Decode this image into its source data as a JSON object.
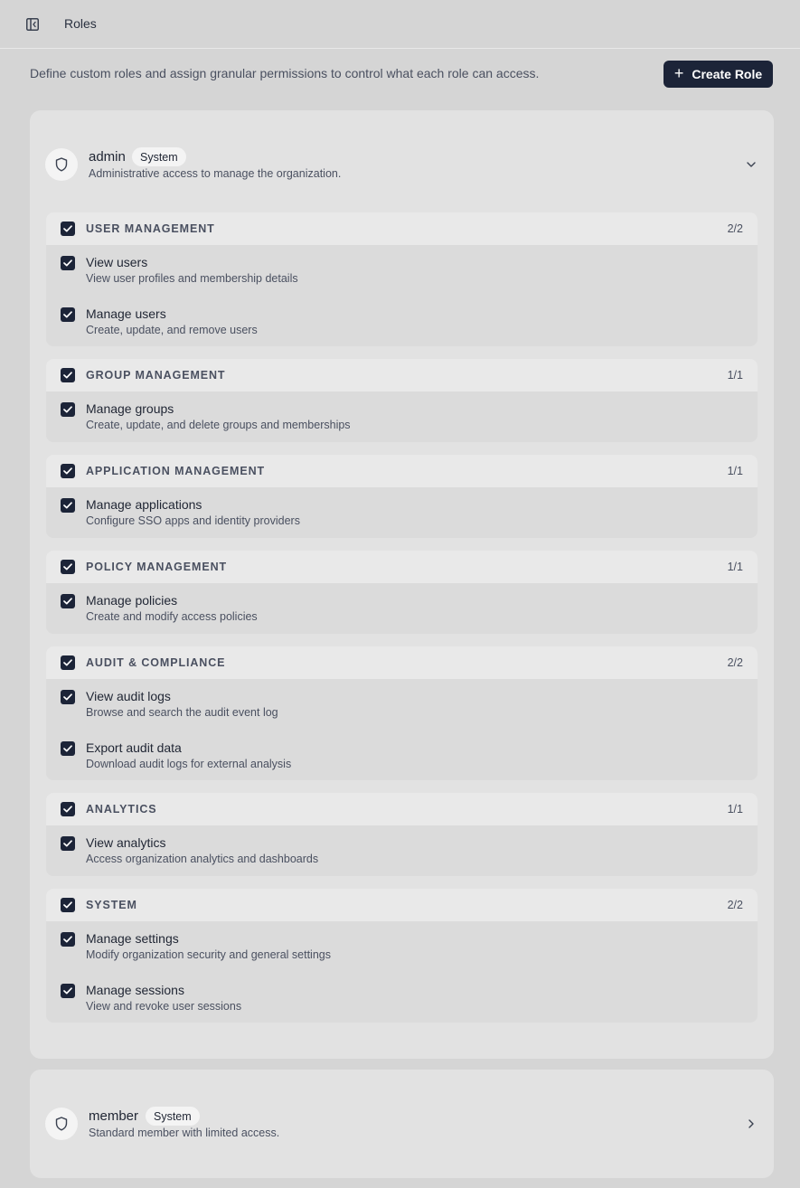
{
  "header": {
    "title": "Roles",
    "toggle_icon": "sidebar-toggle-icon"
  },
  "toolbar": {
    "description": "Define custom roles and assign granular permissions to control what each role can access.",
    "create_label": "Create Role",
    "create_icon": "plus"
  },
  "colors": {
    "accent": "#1c2438",
    "page_bg": "#d5d5d5",
    "card_bg": "#e2e2e2"
  },
  "roles": [
    {
      "name": "admin",
      "badge": "System",
      "description": "Administrative access to manage the organization.",
      "expanded": true,
      "groups": [
        {
          "title": "USER MANAGEMENT",
          "count": "2/2",
          "checked": true,
          "permissions": [
            {
              "name": "View users",
              "description": "View user profiles and membership details",
              "checked": true
            },
            {
              "name": "Manage users",
              "description": "Create, update, and remove users",
              "checked": true
            }
          ]
        },
        {
          "title": "GROUP MANAGEMENT",
          "count": "1/1",
          "checked": true,
          "permissions": [
            {
              "name": "Manage groups",
              "description": "Create, update, and delete groups and memberships",
              "checked": true
            }
          ]
        },
        {
          "title": "APPLICATION MANAGEMENT",
          "count": "1/1",
          "checked": true,
          "permissions": [
            {
              "name": "Manage applications",
              "description": "Configure SSO apps and identity providers",
              "checked": true
            }
          ]
        },
        {
          "title": "POLICY MANAGEMENT",
          "count": "1/1",
          "checked": true,
          "permissions": [
            {
              "name": "Manage policies",
              "description": "Create and modify access policies",
              "checked": true
            }
          ]
        },
        {
          "title": "AUDIT & COMPLIANCE",
          "count": "2/2",
          "checked": true,
          "permissions": [
            {
              "name": "View audit logs",
              "description": "Browse and search the audit event log",
              "checked": true
            },
            {
              "name": "Export audit data",
              "description": "Download audit logs for external analysis",
              "checked": true
            }
          ]
        },
        {
          "title": "ANALYTICS",
          "count": "1/1",
          "checked": true,
          "permissions": [
            {
              "name": "View analytics",
              "description": "Access organization analytics and dashboards",
              "checked": true
            }
          ]
        },
        {
          "title": "SYSTEM",
          "count": "2/2",
          "checked": true,
          "permissions": [
            {
              "name": "Manage settings",
              "description": "Modify organization security and general settings",
              "checked": true
            },
            {
              "name": "Manage sessions",
              "description": "View and revoke user sessions",
              "checked": true
            }
          ]
        }
      ]
    },
    {
      "name": "member",
      "badge": "System",
      "description": "Standard member with limited access.",
      "expanded": false,
      "groups": []
    }
  ]
}
